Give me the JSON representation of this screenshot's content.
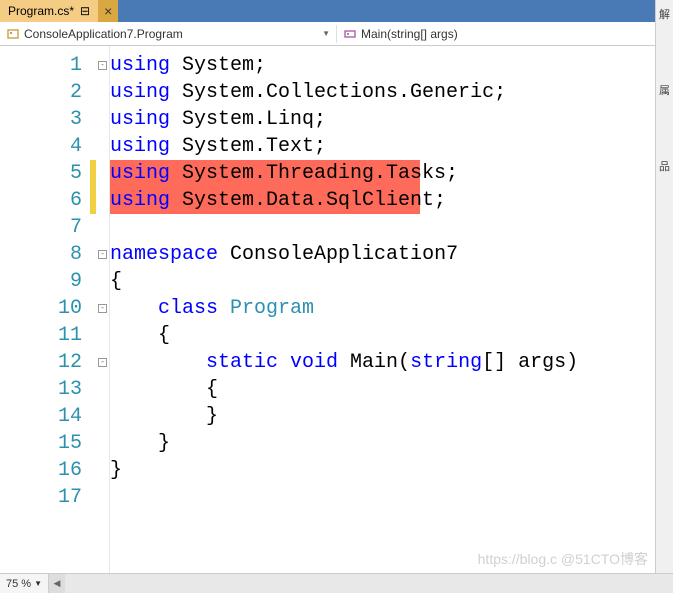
{
  "tab": {
    "title": "Program.cs*",
    "pin": "⊟"
  },
  "nav": {
    "left": "ConsoleApplication7.Program",
    "right": "Main(string[] args)"
  },
  "code": {
    "lines": [
      {
        "n": "1",
        "kw": "using ",
        "rest": "System;"
      },
      {
        "n": "2",
        "kw": "using ",
        "rest": "System.Collections.Generic;"
      },
      {
        "n": "3",
        "kw": "using ",
        "rest": "System.Linq;"
      },
      {
        "n": "4",
        "kw": "using ",
        "rest": "System.Text;"
      },
      {
        "n": "5",
        "kw": "using ",
        "rest": "System.Threading.Tasks;"
      },
      {
        "n": "6",
        "kw": "using ",
        "rest": "System.Data.SqlClient;"
      },
      {
        "n": "7",
        "kw": "",
        "rest": ""
      },
      {
        "n": "8",
        "kw": "namespace ",
        "rest": "ConsoleApplication7"
      },
      {
        "n": "9",
        "kw": "",
        "rest": "{"
      },
      {
        "n": "10",
        "kw": "    class ",
        "typ": "Program",
        "rest2": ""
      },
      {
        "n": "11",
        "kw": "",
        "rest": "    {"
      },
      {
        "n": "12",
        "kw": "        static void ",
        "rest": "Main(",
        "kw2": "string",
        "rest3": "[] args)"
      },
      {
        "n": "13",
        "kw": "",
        "rest": "        {"
      },
      {
        "n": "14",
        "kw": "",
        "rest": "        }"
      },
      {
        "n": "15",
        "kw": "",
        "rest": "    }"
      },
      {
        "n": "16",
        "kw": "",
        "rest": "}"
      },
      {
        "n": "17",
        "kw": "",
        "rest": ""
      }
    ]
  },
  "zoom": "75 %",
  "side": {
    "a": "解",
    "b": "属",
    "c": "品"
  },
  "watermark": "https://blog.c @51CTO博客"
}
